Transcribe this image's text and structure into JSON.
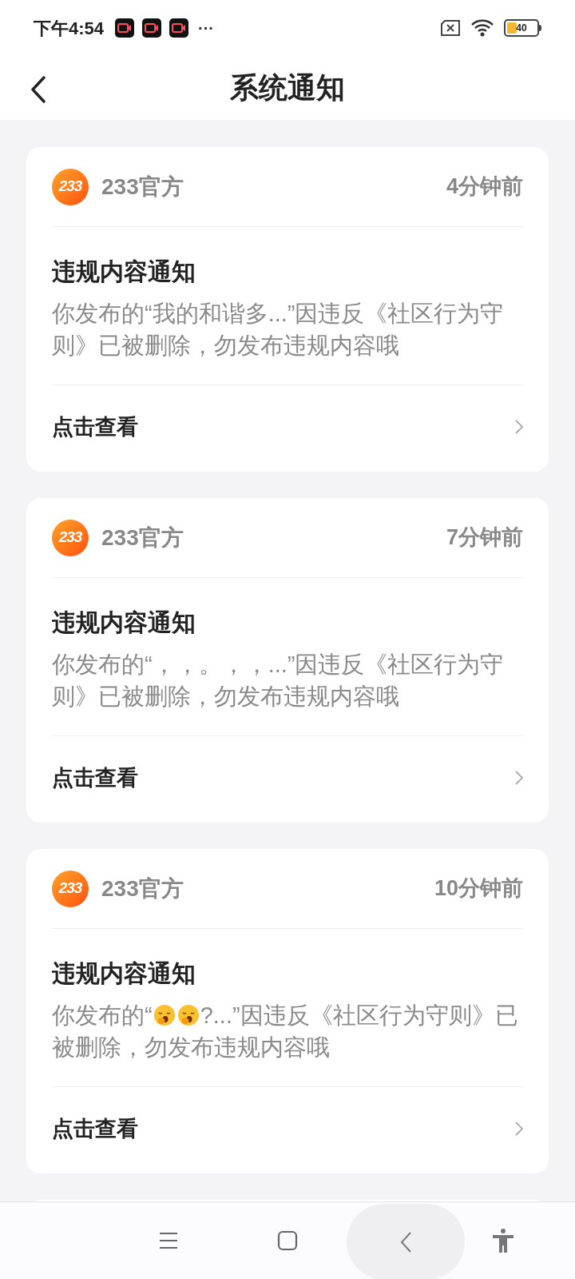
{
  "status_bar": {
    "time": "下午4:54",
    "more": "···",
    "battery": "40"
  },
  "header": {
    "title": "系统通知"
  },
  "notifications": [
    {
      "sender": "233官方",
      "logo": "233",
      "time": "4分钟前",
      "title": "违规内容通知",
      "message": {
        "before": "你发布的“",
        "quote": [
          {
            "kind": "text",
            "text": "我的和谐多..."
          }
        ],
        "after": "”因违反《社区行为守则》已被删除，勿发布违规内容哦"
      },
      "action": "点击查看"
    },
    {
      "sender": "233官方",
      "logo": "233",
      "time": "7分钟前",
      "title": "违规内容通知",
      "message": {
        "before": "你发布的“",
        "quote": [
          {
            "kind": "text",
            "text": "，，。，，..."
          }
        ],
        "after": "”因违反《社区行为守则》已被删除，勿发布违规内容哦"
      },
      "action": "点击查看"
    },
    {
      "sender": "233官方",
      "logo": "233",
      "time": "10分钟前",
      "title": "违规内容通知",
      "message": {
        "before": "你发布的“",
        "quote": [
          {
            "kind": "emoji"
          },
          {
            "kind": "emoji"
          },
          {
            "kind": "text",
            "text": "?..."
          }
        ],
        "after": "”因违反《社区行为守则》已被删除，勿发布违规内容哦"
      },
      "action": "点击查看"
    }
  ]
}
